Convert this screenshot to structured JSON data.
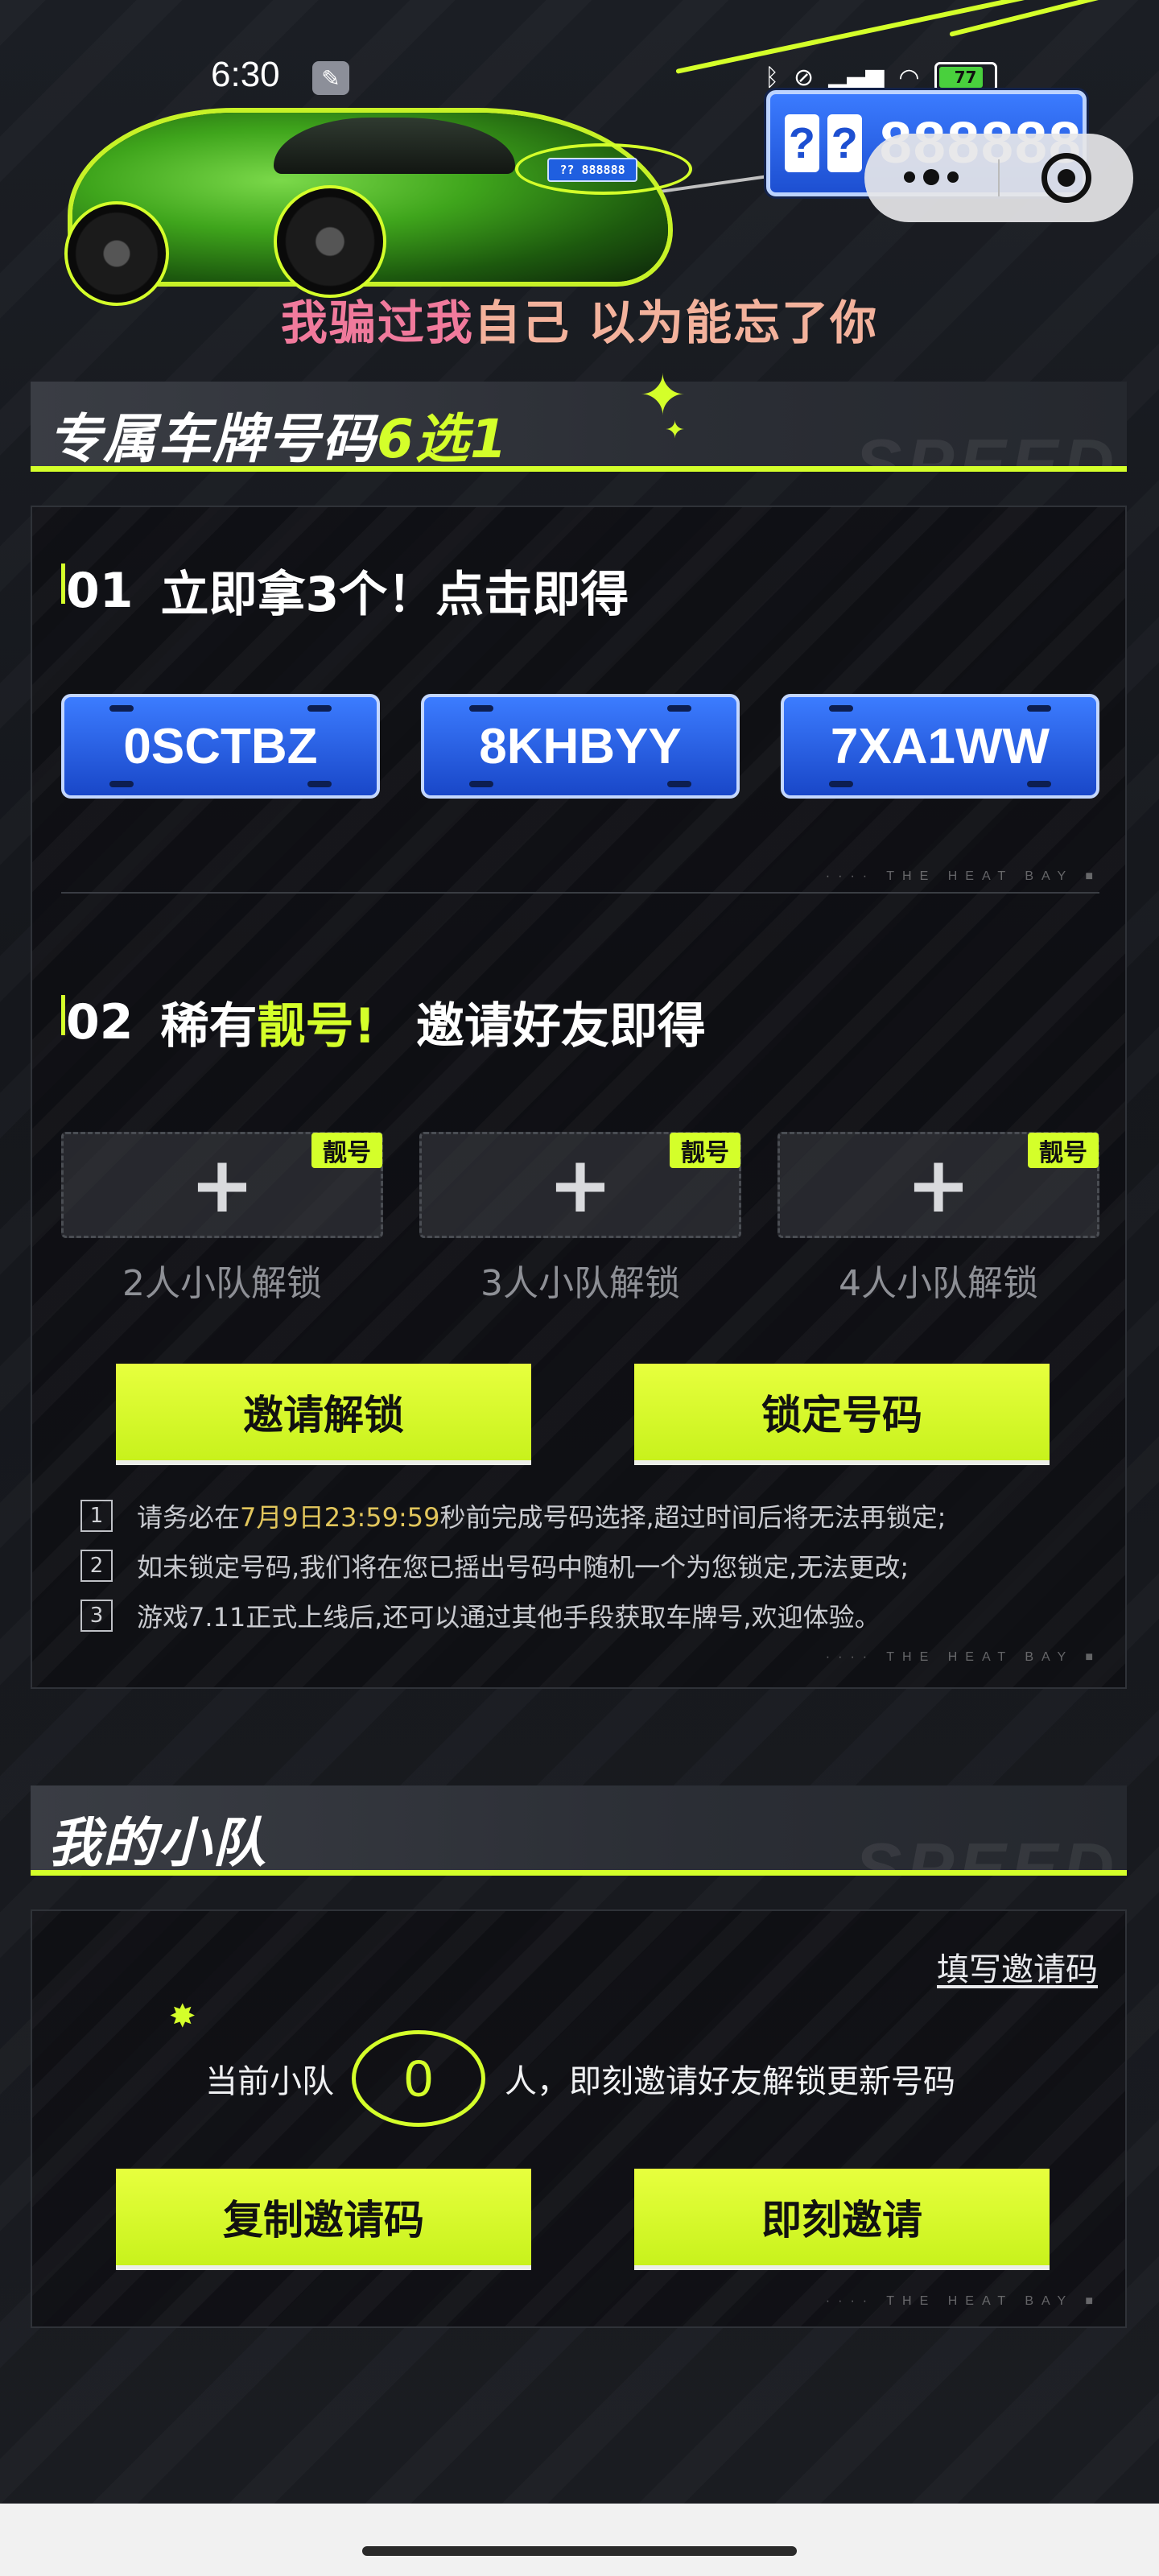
{
  "status_bar": {
    "time": "6:30",
    "battery": "77"
  },
  "hero": {
    "car_plate": "?? 888888",
    "top_plate_marks": [
      "?",
      "?"
    ],
    "top_plate_number": "888888",
    "lyric_part1": "我骗过我",
    "lyric_part2": "自己 以为能忘了你"
  },
  "section1": {
    "title_prefix": "专属车牌号码",
    "title_accent": "6选1",
    "watermark": "SPEED"
  },
  "step1": {
    "number": "01",
    "title": "立即拿3个！点击即得",
    "plates": [
      "0SCTBZ",
      "8KHBYY",
      "7XA1WW"
    ],
    "tag": "···· THE HEAT BAY ■"
  },
  "step2": {
    "number": "02",
    "title_prefix": "稀有",
    "title_accent": "靓号!",
    "title_suffix": "邀请好友即得",
    "slot_badge": "靓号",
    "slot_plus": "+",
    "slot_labels": [
      "2人小队解锁",
      "3人小队解锁",
      "4人小队解锁"
    ],
    "invite_unlock_label": "邀请解锁",
    "lock_number_label": "锁定号码",
    "rules": [
      {
        "num": "1",
        "before": "请务必在",
        "highlight": "7月9日23:59:59",
        "after": "秒前完成号码选择,超过时间后将无法再锁定;"
      },
      {
        "num": "2",
        "text": "如未锁定号码,我们将在您已摇出号码中随机一个为您锁定,无法更改;"
      },
      {
        "num": "3",
        "text": "游戏7.11正式上线后,还可以通过其他手段获取车牌号,欢迎体验。"
      }
    ],
    "tag": "···· THE HEAT BAY ■"
  },
  "section2": {
    "title": "我的小队",
    "watermark": "SPEED"
  },
  "team": {
    "enter_invite_code": "填写邀请码",
    "current_team_label": "当前小队",
    "count": "0",
    "suffix": "人，即刻邀请好友解锁更新号码",
    "copy_code_label": "复制邀请码",
    "invite_now_label": "即刻邀请",
    "tag": "···· THE HEAT BAY ■"
  },
  "colors": {
    "accent": "#d4ff2a",
    "plate_blue": "#1f5fe0",
    "lyric_pink": "#f07a9c"
  }
}
